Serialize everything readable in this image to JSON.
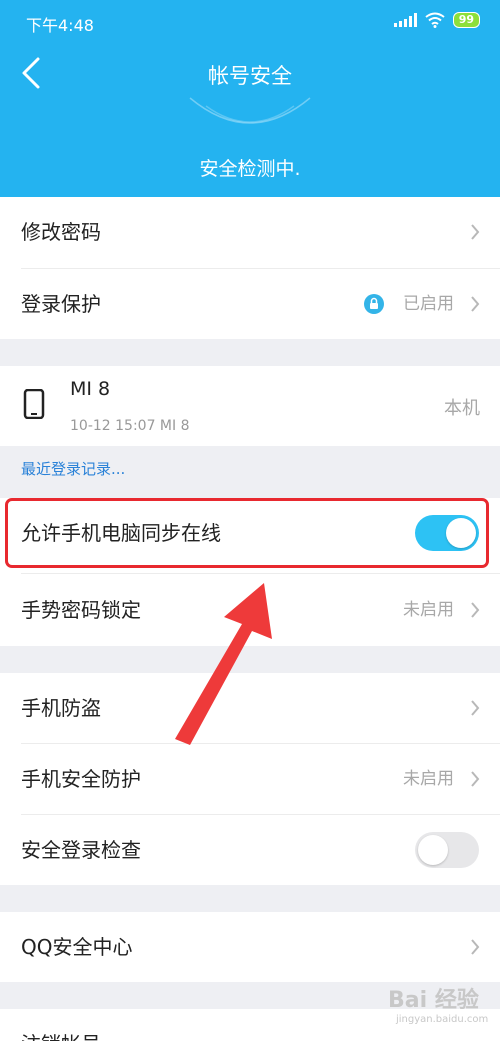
{
  "status": {
    "time": "下午4:48",
    "battery": "99"
  },
  "header": {
    "title": "帐号安全",
    "scan_text": "安全检测中."
  },
  "rows": {
    "change_password": {
      "label": "修改密码"
    },
    "login_protect": {
      "label": "登录保护",
      "value": "已启用"
    },
    "device": {
      "name": "MI 8",
      "sub": "10-12 15:07 MI 8",
      "tag": "本机"
    },
    "recent_login": {
      "label": "最近登录记录..."
    },
    "sync_online": {
      "label": "允许手机电脑同步在线",
      "enabled": true
    },
    "gesture_lock": {
      "label": "手势密码锁定",
      "value": "未启用"
    },
    "anti_theft": {
      "label": "手机防盗"
    },
    "phone_security": {
      "label": "手机安全防护",
      "value": "未启用"
    },
    "login_check": {
      "label": "安全登录检查",
      "enabled": false
    },
    "qq_security": {
      "label": "QQ安全中心"
    },
    "cancel_account": {
      "label": "注销帐号"
    }
  },
  "watermark": {
    "main": "Bai 经验",
    "sub": "jingyan.baidu.com"
  },
  "colors": {
    "header": "#24b3f0",
    "toggle_on": "#2dc2f4",
    "highlight": "#e8292f",
    "link": "#2a82d8"
  }
}
